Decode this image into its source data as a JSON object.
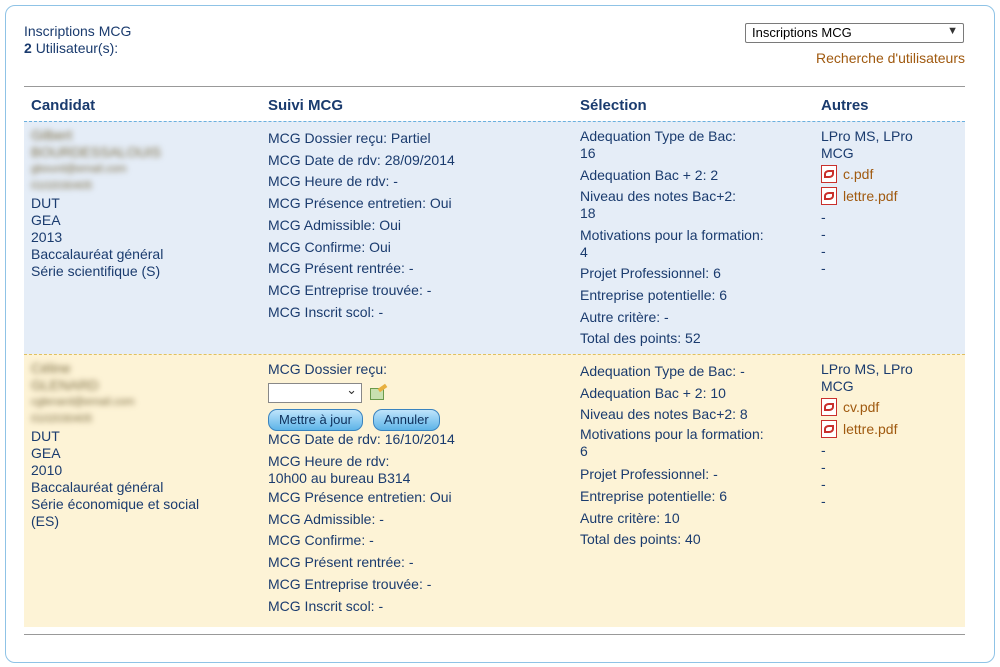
{
  "header": {
    "title": "Inscriptions MCG",
    "user_count": "2",
    "user_label": "Utilisateur(s):",
    "selector_value": "Inscriptions MCG",
    "search_link": "Recherche d'utilisateurs"
  },
  "columns": [
    "Candidat",
    "Suivi MCG",
    "Sélection",
    "Autres"
  ],
  "rows": [
    {
      "candidat": {
        "name1": "Gilbert",
        "name2": "BOURDESSALOUIS",
        "email": "gbourd@email.com",
        "phone": "0102030405",
        "lines": [
          "DUT",
          "GEA",
          "2013",
          "Baccalauréat général",
          "Série scientifique (S)"
        ]
      },
      "suivi": [
        "MCG Dossier reçu: Partiel",
        "MCG Date de rdv: 28/09/2014",
        "MCG Heure de rdv: -",
        "MCG Présence entretien: Oui",
        "MCG Admissible: Oui",
        "MCG Confirme: Oui",
        "MCG Présent rentrée: -",
        "MCG Entreprise trouvée: -",
        "MCG Inscrit scol: -"
      ],
      "selection": [
        [
          "Adequation Type de Bac:",
          "16"
        ],
        [
          "Adequation Bac + 2: 2"
        ],
        [
          "Niveau des notes Bac+2:",
          "18"
        ],
        [
          "Motivations pour la formation:",
          "4"
        ],
        [
          "Projet Professionnel: 6"
        ],
        [
          "Entreprise potentielle: 6"
        ],
        [
          "Autre critère: -"
        ],
        [
          "Total des points: 52"
        ]
      ],
      "autres": {
        "formation": [
          "LPro MS, LPro",
          "MCG"
        ],
        "files": [
          "c.pdf",
          "lettre.pdf"
        ],
        "dashes": [
          "-",
          "-",
          "-",
          "-"
        ]
      }
    },
    {
      "candidat": {
        "name1": "Céline",
        "name2": "GLENARD",
        "email": "cglenard@email.com",
        "phone": "0102030405",
        "lines": [
          "DUT",
          "GEA",
          "2010",
          "Baccalauréat général",
          "Série économique et social",
          "(ES)"
        ]
      },
      "suivi": {
        "dossier_label": "MCG Dossier reçu:",
        "update_button": "Mettre à jour",
        "cancel_button": "Annuler",
        "date": "MCG Date de rdv: 16/10/2014",
        "heure": [
          "MCG Heure de rdv:",
          "10h00 au bureau B314"
        ],
        "rest": [
          "MCG Présence entretien: Oui",
          "MCG Admissible: -",
          "MCG Confirme: -",
          "MCG Présent rentrée: -",
          "MCG Entreprise trouvée: -",
          "MCG Inscrit scol: -"
        ]
      },
      "selection": [
        [
          "Adequation Type de Bac: -"
        ],
        [
          "Adequation Bac + 2: 10"
        ],
        [
          "Niveau des notes Bac+2: 8"
        ],
        [
          "Motivations pour la formation:",
          "6"
        ],
        [
          "Projet Professionnel: -"
        ],
        [
          "Entreprise potentielle: 6"
        ],
        [
          "Autre critère: 10"
        ],
        [
          "Total des points: 40"
        ]
      ],
      "autres": {
        "formation": [
          "LPro MS, LPro",
          "MCG"
        ],
        "files": [
          "cv.pdf",
          "lettre.pdf"
        ],
        "dashes": [
          "-",
          "-",
          "-",
          "-"
        ]
      }
    }
  ]
}
